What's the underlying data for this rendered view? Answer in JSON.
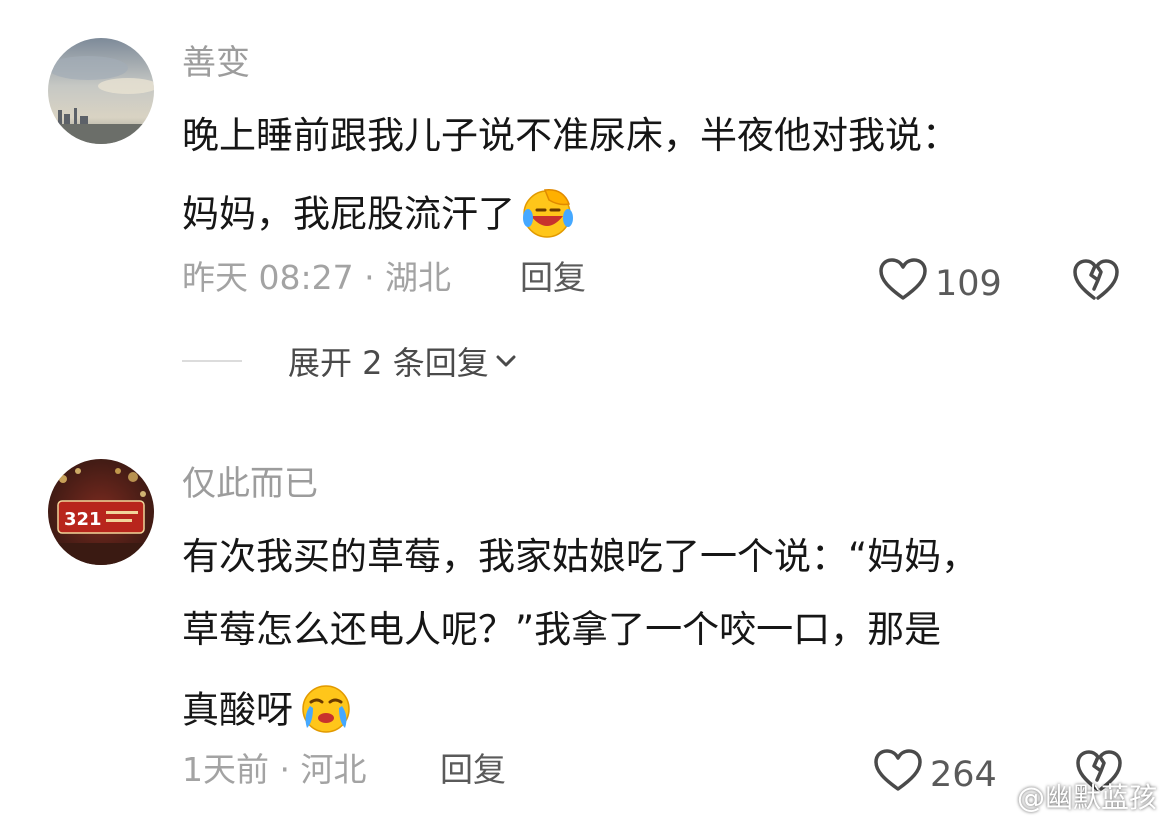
{
  "comments": [
    {
      "username": "善变",
      "text_line1": "晚上睡前跟我儿子说不准尿床，半夜他对我说：",
      "text_line2": "妈妈，我屁股流汗了",
      "emoji": "facepalm-laughing-emoji",
      "time_location": "昨天 08:27 · 湖北",
      "reply_label": "回复",
      "likes": "109",
      "expand_label": "展开 2 条回复"
    },
    {
      "username": "仅此而已",
      "text_line1": "有次我买的草莓，我家姑娘吃了一个说：“妈妈，",
      "text_line2": "草莓怎么还电人呢？”我拿了一个咬一口，那是",
      "text_line3": "真酸呀",
      "emoji": "crying-face-emoji",
      "avatar_text": "321",
      "time_location": "1天前 · 河北",
      "reply_label": "回复",
      "likes": "264"
    }
  ],
  "icons": {
    "like": "heart-outline-icon",
    "dislike": "broken-heart-icon",
    "expand": "chevron-down-icon"
  },
  "watermark": "@幽默蓝孩"
}
